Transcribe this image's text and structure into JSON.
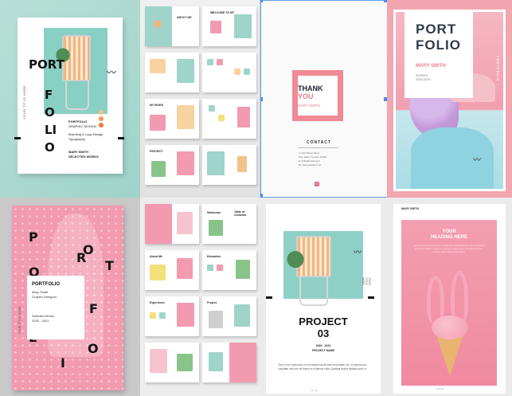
{
  "cover_teal": {
    "title_port": "PORT",
    "title_folio": "FOLIO",
    "side_title": "YOUR TITLE HERE",
    "portfolio_label": "PORTFOLIO",
    "discipline": "GRAPHIC DESIGN",
    "services_line1": "Branding & Logo Design",
    "services_line2": "Typography",
    "author": "MARY SMITH",
    "works": "SELECTED WORKS",
    "dot_colors": [
      "#f5c27a",
      "#f39a4b",
      "#f07b2f"
    ]
  },
  "spreads_top": {
    "welcome_label": "WELCOME TO MY",
    "about_label": "ABOUT ME",
    "my_work_label": "MY WORK",
    "project_label": "PROJECT"
  },
  "thank_you": {
    "thank": "THANK",
    "you": "YOU",
    "name": "MARY SMITH",
    "contact": "CONTACT",
    "contact_lines": [
      "A: 123 Street Name",
      "City, State, Country 12345",
      "E: hello@email.com",
      "W: www.website.com"
    ]
  },
  "cover_pink": {
    "title_line1": "PORT",
    "title_line2": "FOLIO",
    "name": "MARY SMITH",
    "works_line1": "WORKS",
    "works_line2": "2020-2021",
    "vertical": "PORTFOLIO"
  },
  "cover_dotted": {
    "letters": [
      "P",
      "O",
      "R",
      "T",
      "F",
      "O",
      "L",
      "I",
      "O"
    ],
    "box_title": "PORTFOLIO",
    "box_line1": "Mary Smith",
    "box_line2": "Graphic Designer",
    "box_line3": "Selected Works",
    "box_line4": "2020 - 2021",
    "side_title": "YOUR TITLE HERE"
  },
  "spreads_bottom": {
    "welcome": "Welcome",
    "toc": "Table of Contents",
    "about": "About Me",
    "education": "Education",
    "experience": "Experience",
    "project": "Project"
  },
  "project_page": {
    "title_line1": "PROJECT",
    "title_line2": "03",
    "years": "2020 - 2021",
    "name": "PROJECT NAME",
    "body": "Sed ut non nulla dolor ut et excepturi at sit erat non pariatur vel. Ut placet nunc voluptate velit non sit bueno et ut laboris nulla. Quisque dolore facilisis dolor ut.",
    "page_num": "14 / 16",
    "vertical": "YOUR TITLE HERE"
  },
  "icecream_page": {
    "author": "MARY SMITH",
    "heading_line1": "YOUR",
    "heading_line2": "HEADING HERE",
    "lorem": "Lorem ipsum dolor sit amet, consectetur adipiscing elit, sed do eiusmod tempor incididunt ut labore et dolore magna aliqua. Ut enim ad minim veniam, quis nostrud exercitation.",
    "page_num": "15 / 16"
  }
}
